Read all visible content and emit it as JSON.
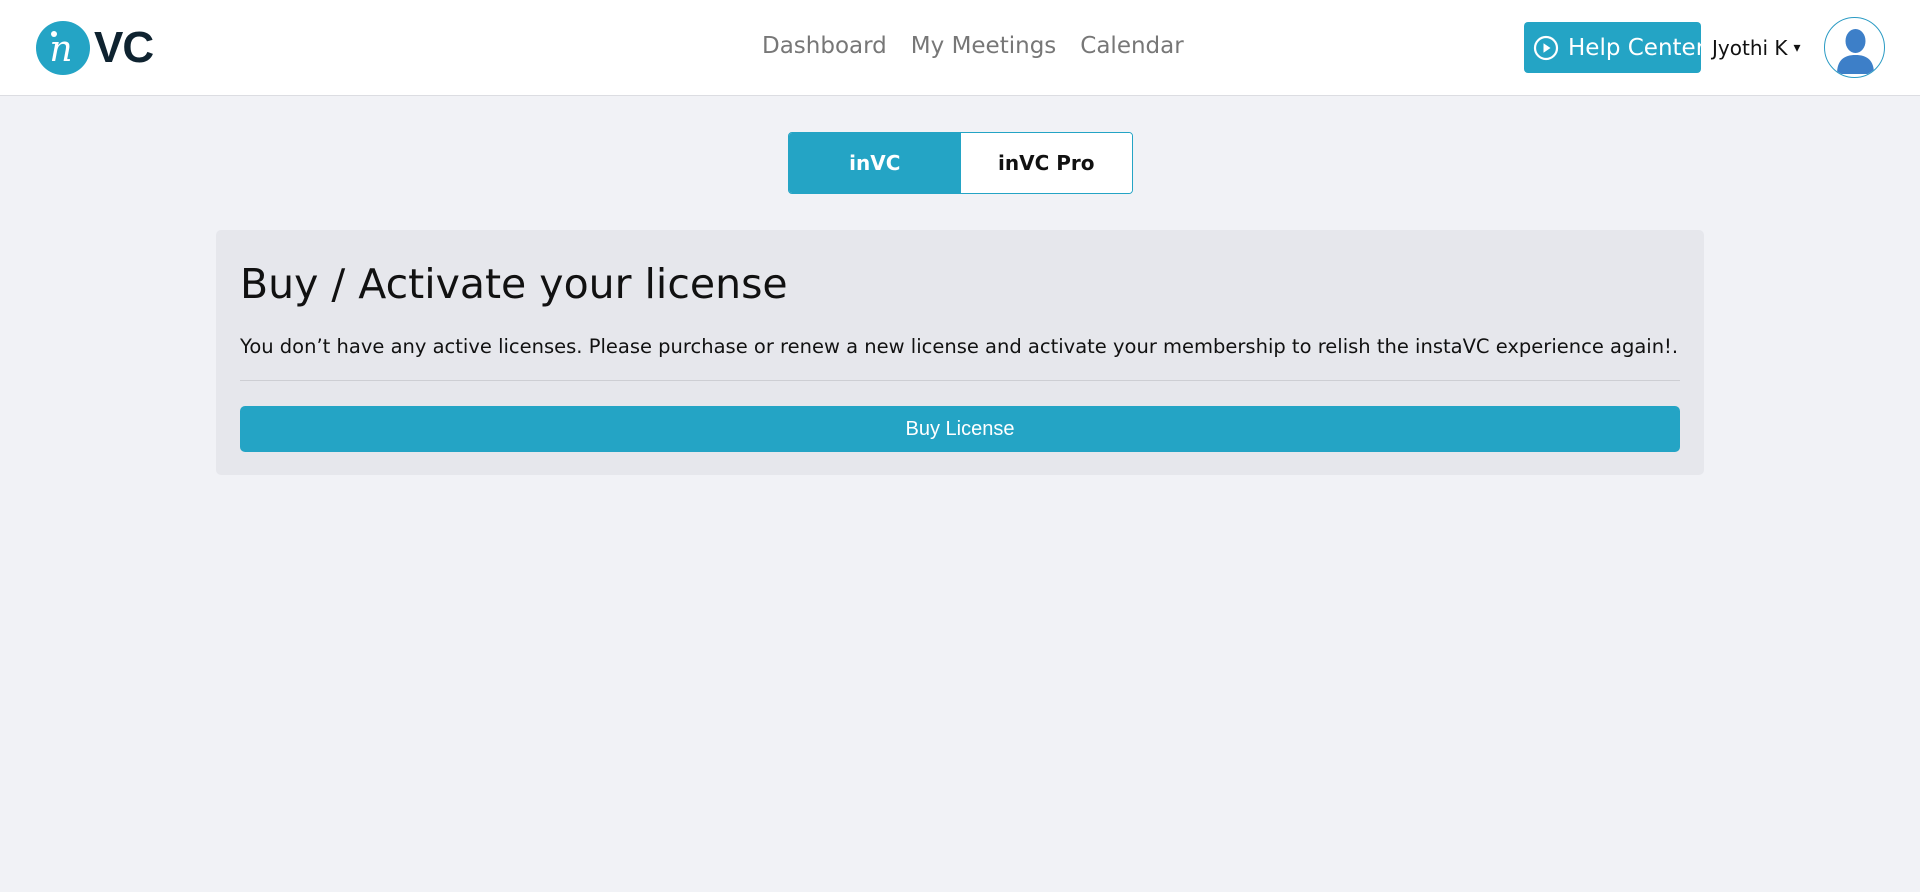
{
  "header": {
    "logo": {
      "text": "VC",
      "mark_icon": "invc-logo-mark",
      "brand_color": "#24a4c5"
    },
    "nav": [
      {
        "label": "Dashboard"
      },
      {
        "label": "My Meetings"
      },
      {
        "label": "Calendar"
      }
    ],
    "help_center": {
      "label": "Help Center",
      "icon": "play-circle-icon"
    },
    "user": {
      "name": "Jyothi K",
      "caret": "▾"
    }
  },
  "product_toggle": {
    "options": [
      {
        "label": "inVC",
        "active": true
      },
      {
        "label": "inVC Pro",
        "active": false
      }
    ]
  },
  "license_card": {
    "title": "Buy / Activate your license",
    "message": "You don’t have any active licenses. Please purchase or renew a new license and activate your membership to relish the instaVC experience again!.",
    "button_label": "Buy License"
  },
  "colors": {
    "accent": "#24a4c5",
    "page_bg": "#f1f2f6",
    "card_bg": "#e6e7ec"
  }
}
